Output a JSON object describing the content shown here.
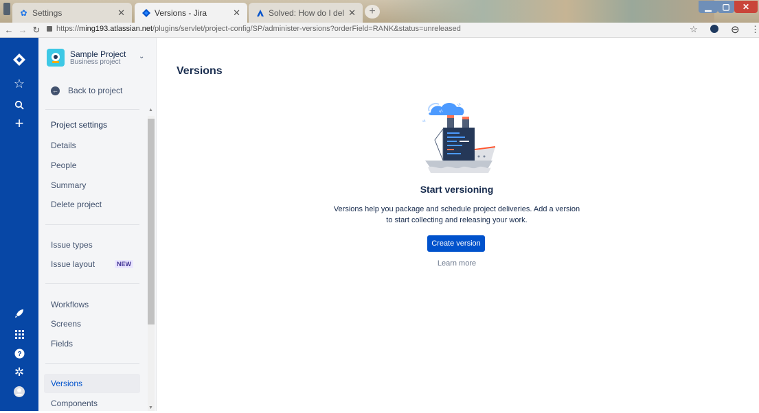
{
  "browser": {
    "tabs": [
      {
        "title": "Settings",
        "icon": "gear-icon",
        "active": false
      },
      {
        "title": "Versions - Jira",
        "icon": "jira-icon",
        "active": true
      },
      {
        "title": "Solved: How do I delete a projec",
        "icon": "atlassian-icon",
        "active": false
      }
    ],
    "url_prefix": "https://",
    "url_host": "ming193.atlassian.net",
    "url_path": "/plugins/servlet/project-config/SP/administer-versions?orderField=RANK&status=unreleased"
  },
  "global_nav": {
    "icons": [
      "jira-logo-icon",
      "star-icon",
      "search-icon",
      "plus-icon",
      "rocket-icon",
      "app-switcher-icon",
      "help-icon",
      "settings-icon",
      "profile-icon"
    ]
  },
  "sidebar": {
    "project_name": "Sample Project",
    "project_type": "Business project",
    "back_label": "Back to project",
    "groups": [
      [
        {
          "label": "Project settings",
          "heading": true
        },
        {
          "label": "Details"
        },
        {
          "label": "People"
        },
        {
          "label": "Summary"
        },
        {
          "label": "Delete project"
        }
      ],
      [
        {
          "label": "Issue types"
        },
        {
          "label": "Issue layout",
          "badge": "NEW"
        }
      ],
      [
        {
          "label": "Workflows"
        },
        {
          "label": "Screens"
        },
        {
          "label": "Fields"
        }
      ],
      [
        {
          "label": "Versions",
          "selected": true
        },
        {
          "label": "Components"
        }
      ]
    ]
  },
  "main": {
    "title": "Versions",
    "empty_state": {
      "heading": "Start versioning",
      "description": "Versions help you package and schedule project deliveries. Add a version to start collecting and releasing your work.",
      "primary_button": "Create version",
      "secondary_link": "Learn more"
    }
  },
  "colors": {
    "global_nav": "#0747a6",
    "primary": "#0052cc",
    "sidebar_bg": "#f4f5f7",
    "text": "#172b4d"
  }
}
